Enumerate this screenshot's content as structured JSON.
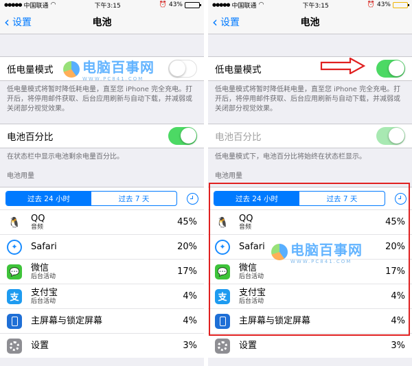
{
  "status": {
    "carrier": "中国联通",
    "time": "下午3:15",
    "battery_pct": "43%",
    "battery_level": 0.43
  },
  "nav": {
    "back_label": "设置",
    "title": "电池"
  },
  "low_power": {
    "label": "低电量模式",
    "description": "低电量模式将暂时降低耗电量，直至您 iPhone 完全充电。打开后，将停用邮件获取、后台应用刷新与自动下载，并减弱或关闭部分视觉效果。"
  },
  "battery_pct_row": {
    "label": "电池百分比",
    "left_description": "在状态栏中显示电池剩余电量百分比。",
    "right_description": "低电量模式下，电池百分比将始终在状态栏显示。"
  },
  "usage": {
    "header": "电池用量",
    "segments": [
      "过去 24 小时",
      "过去 7 天"
    ],
    "apps": [
      {
        "name": "QQ",
        "sub": "音频",
        "pct": "45%"
      },
      {
        "name": "Safari",
        "sub": "",
        "pct": "20%"
      },
      {
        "name": "微信",
        "sub": "后台活动",
        "pct": "17%"
      },
      {
        "name": "支付宝",
        "sub": "后台活动",
        "pct": "4%"
      },
      {
        "name": "主屏幕与锁定屏幕",
        "sub": "",
        "pct": "4%"
      },
      {
        "name": "设置",
        "sub": "",
        "pct": "3%"
      }
    ]
  },
  "watermark": {
    "main": "电脑百事网",
    "sub": "WWW.PC841.COM"
  },
  "colors": {
    "accent": "#007aff",
    "toggle_on": "#4cd964",
    "highlight": "#e02020"
  }
}
